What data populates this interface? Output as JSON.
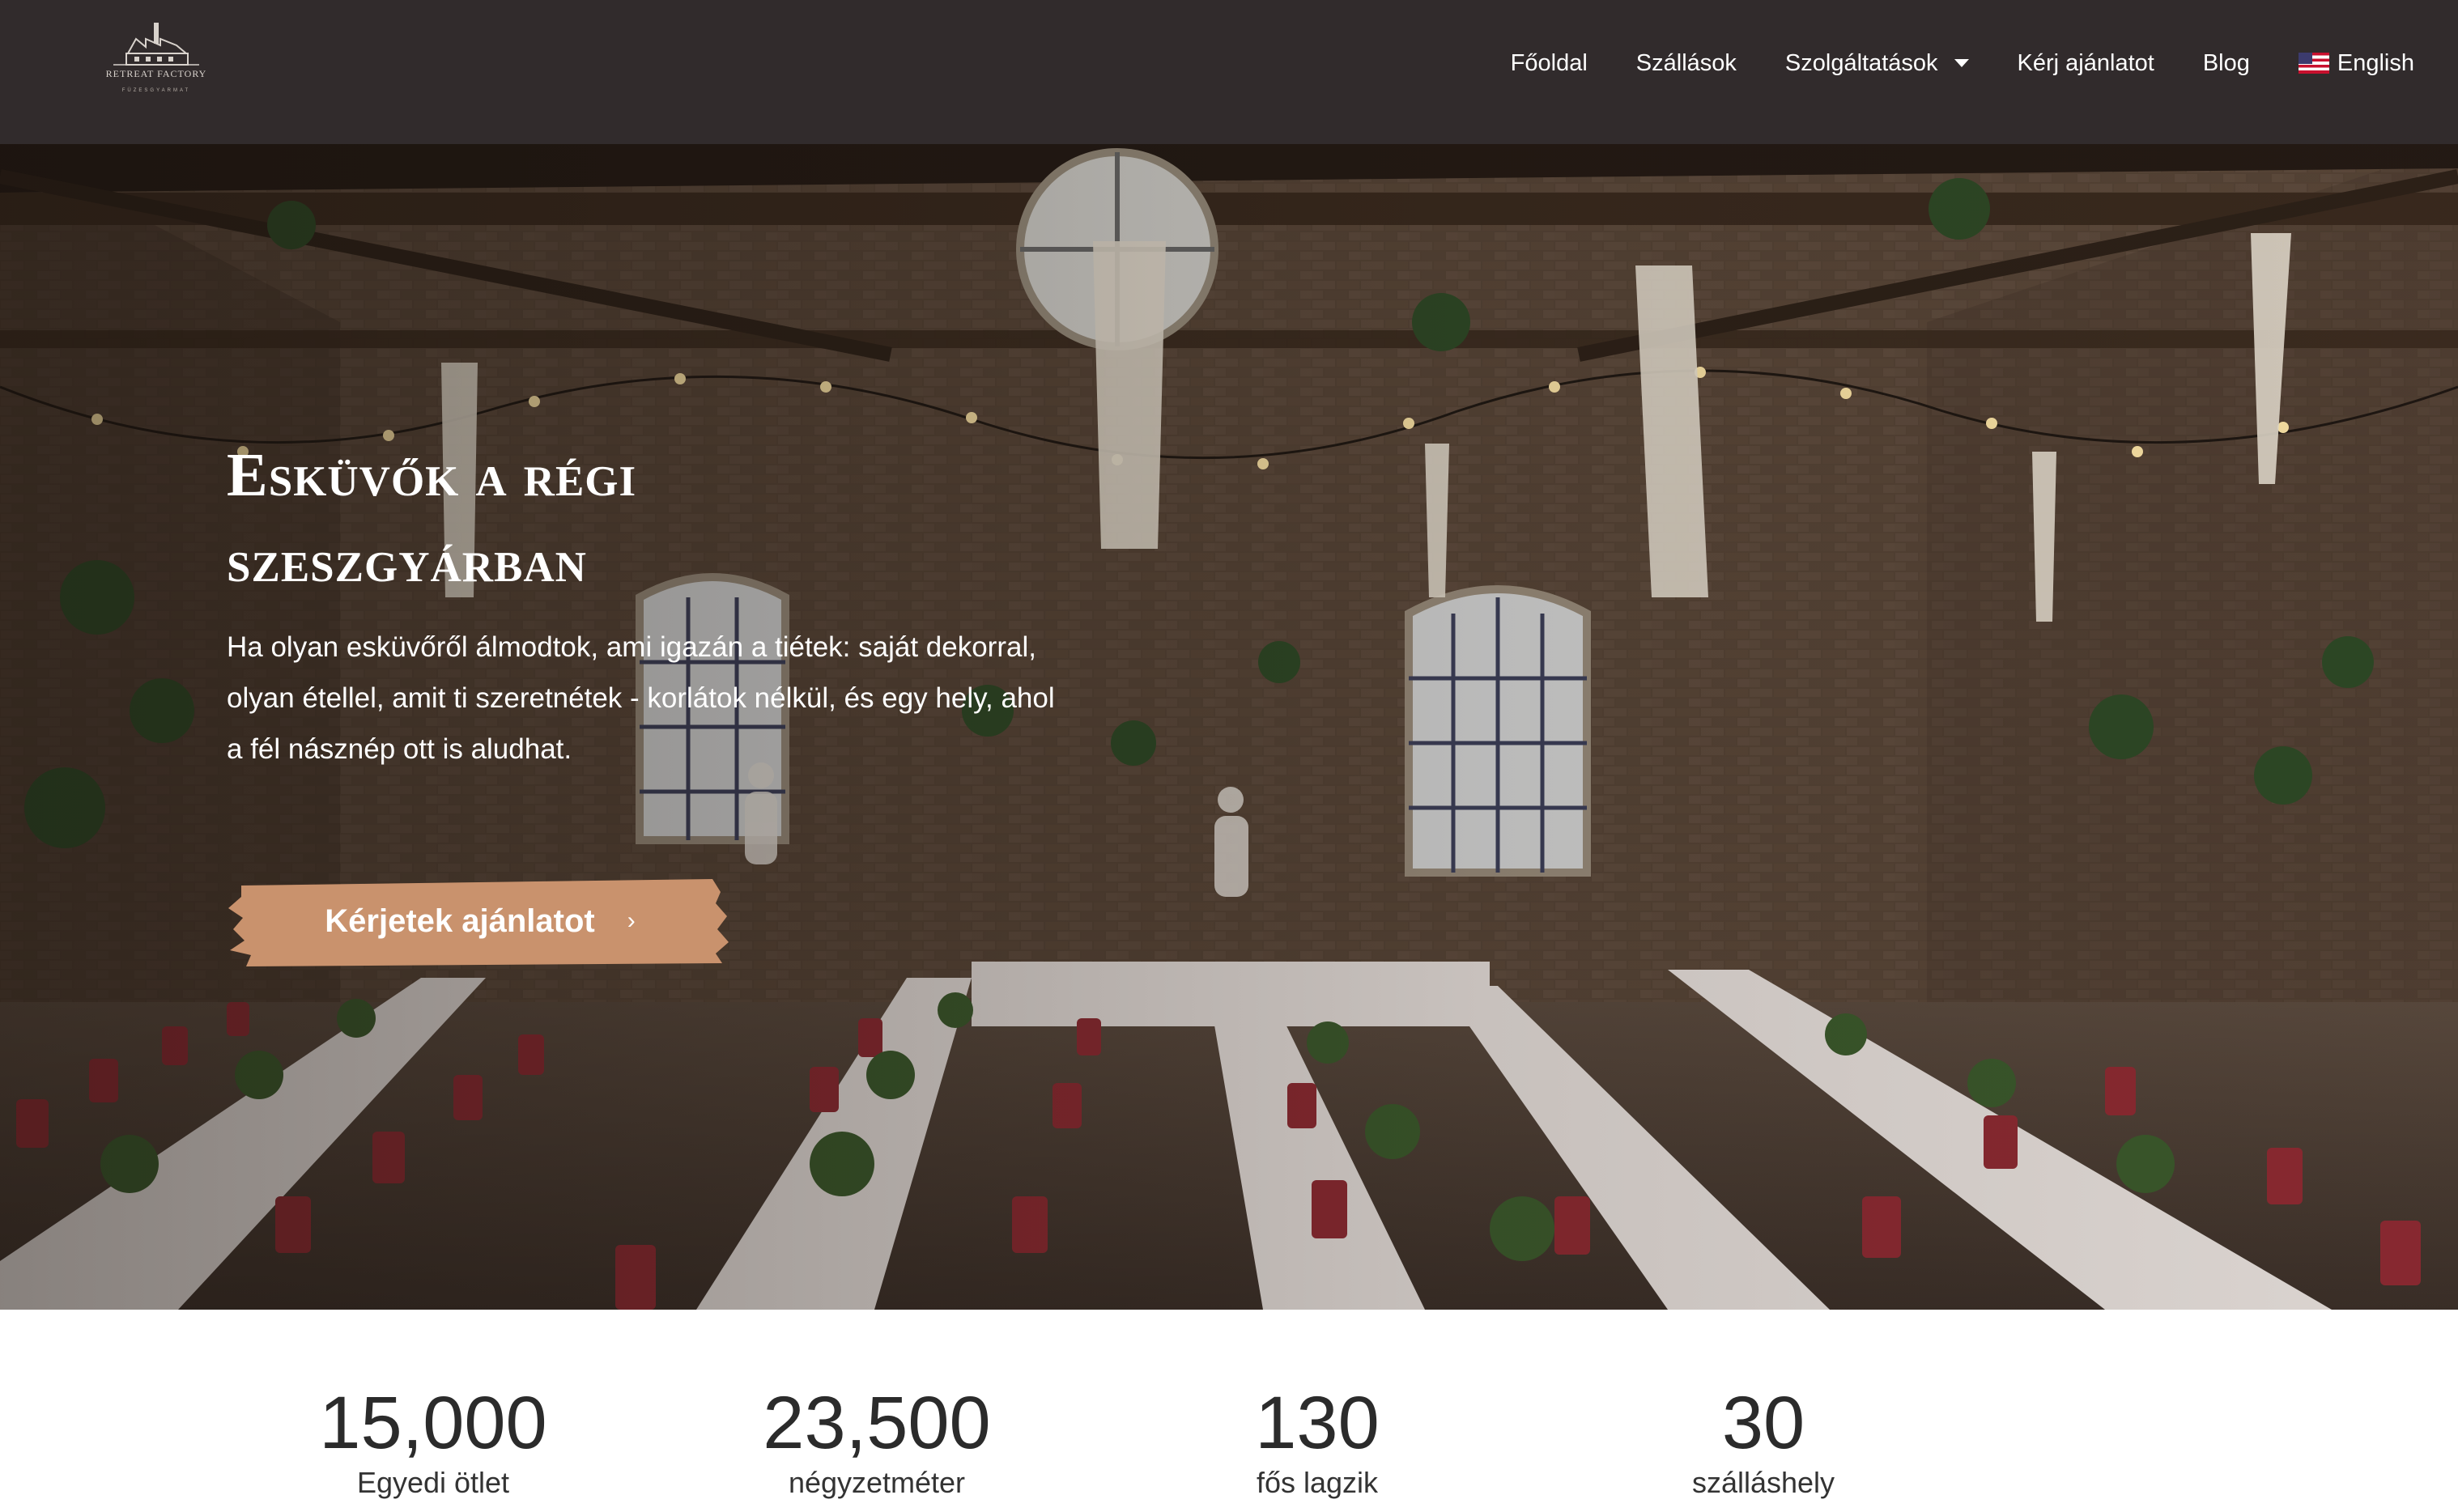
{
  "header": {
    "logo": {
      "name": "RETREAT FACTORY",
      "subtitle": "FÜZESGYARMAT"
    },
    "nav": [
      {
        "label": "Főoldal"
      },
      {
        "label": "Szállások"
      },
      {
        "label": "Szolgáltatások",
        "has_dropdown": true
      },
      {
        "label": "Kérj ajánlatot"
      },
      {
        "label": "Blog"
      },
      {
        "label": "English",
        "icon": "us-flag-icon"
      }
    ]
  },
  "hero": {
    "title_line1": "Esküvők a régi",
    "title_line2": "szeszgyárban",
    "text": "Ha olyan esküvőről álmodtok, ami igazán a tiétek: saját dekorral, olyan étellel, amit ti szeretnétek - korlátok nélkül, és egy hely, ahol a fél násznép ott is aludhat.",
    "cta_label": "Kérjetek ajánlatot",
    "cta_icon": "chevron-right-icon"
  },
  "stats": [
    {
      "number": "15,000",
      "label": "Egyedi ötlet"
    },
    {
      "number": "23,500",
      "label": "négyzetméter"
    },
    {
      "number": "130",
      "label": "fős lagzik"
    },
    {
      "number": "30",
      "label": "szálláshely"
    }
  ],
  "colors": {
    "header_bg": "#312b2c",
    "cta_bg": "#c9926d",
    "text_dark": "#2b2b2b"
  }
}
